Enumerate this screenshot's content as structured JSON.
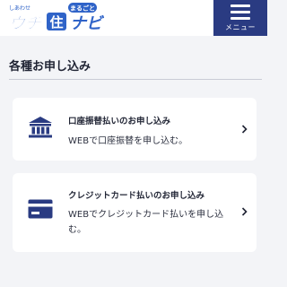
{
  "header": {
    "logo_small": "しあわせ",
    "logo_badge": "まるごと",
    "logo_text_1": "ウチ",
    "logo_kanji": "住",
    "logo_text_2": "ナビ",
    "menu_label": "メニュー"
  },
  "page": {
    "title": "各種お申し込み"
  },
  "cards": [
    {
      "icon": "bank-icon",
      "title": "口座振替払いのお申し込み",
      "description": "WEBで口座振替を申し込む。"
    },
    {
      "icon": "credit-card-icon",
      "title": "クレジットカード払いのお申し込み",
      "description": "WEBでクレジットカード払いを申し込む。"
    }
  ],
  "colors": {
    "brand": "#2a3b82",
    "background": "#f3f4f7",
    "logo_blue": "#2f63c8"
  }
}
